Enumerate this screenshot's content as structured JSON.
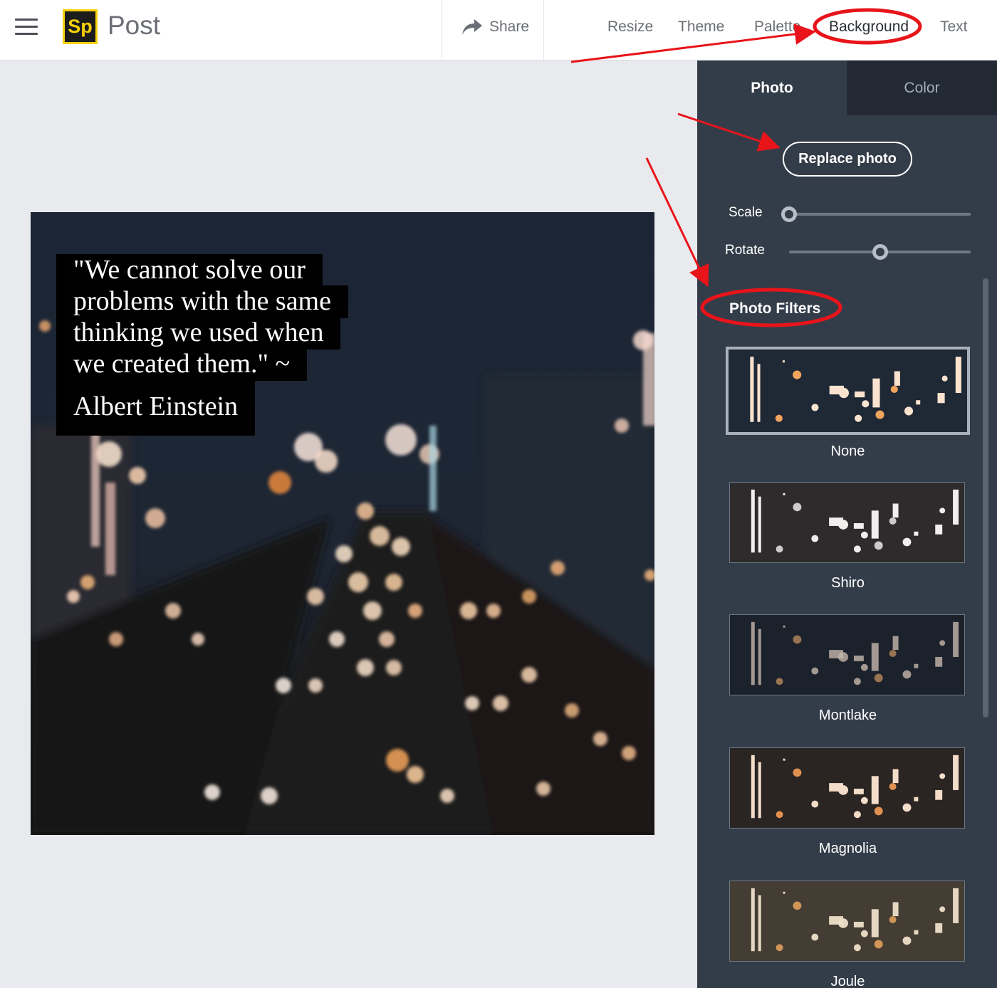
{
  "header": {
    "menu_icon": "hamburger-menu-icon",
    "logo_text": "Sp",
    "app_title": "Post",
    "share_label": "Share",
    "share_icon": "share-arrow-icon",
    "nav": [
      {
        "label": "Resize"
      },
      {
        "label": "Theme"
      },
      {
        "label": "Palette"
      },
      {
        "label": "Background",
        "active": true
      },
      {
        "label": "Text"
      }
    ]
  },
  "canvas": {
    "quote_lines": [
      "\"We cannot solve our",
      "problems with the same",
      "thinking we used when",
      "we created them.\" ~",
      "Albert Einstein"
    ]
  },
  "panel": {
    "tabs": [
      {
        "label": "Photo",
        "active": true
      },
      {
        "label": "Color",
        "active": false
      }
    ],
    "replace_label": "Replace photo",
    "sliders": [
      {
        "label": "Scale",
        "value_fraction": 0.0
      },
      {
        "label": "Rotate",
        "value_fraction": 0.5
      }
    ],
    "filters_heading": "Photo Filters",
    "filters": [
      {
        "name": "None",
        "selected": true
      },
      {
        "name": "Shiro",
        "selected": false
      },
      {
        "name": "Montlake",
        "selected": false
      },
      {
        "name": "Magnolia",
        "selected": false
      },
      {
        "name": "Joule",
        "selected": false
      }
    ]
  },
  "colors": {
    "logo_bg": "#1c1c1c",
    "logo_accent": "#f5d10b",
    "panel_bg": "#333d49",
    "annotation_red": "#e8141a"
  }
}
